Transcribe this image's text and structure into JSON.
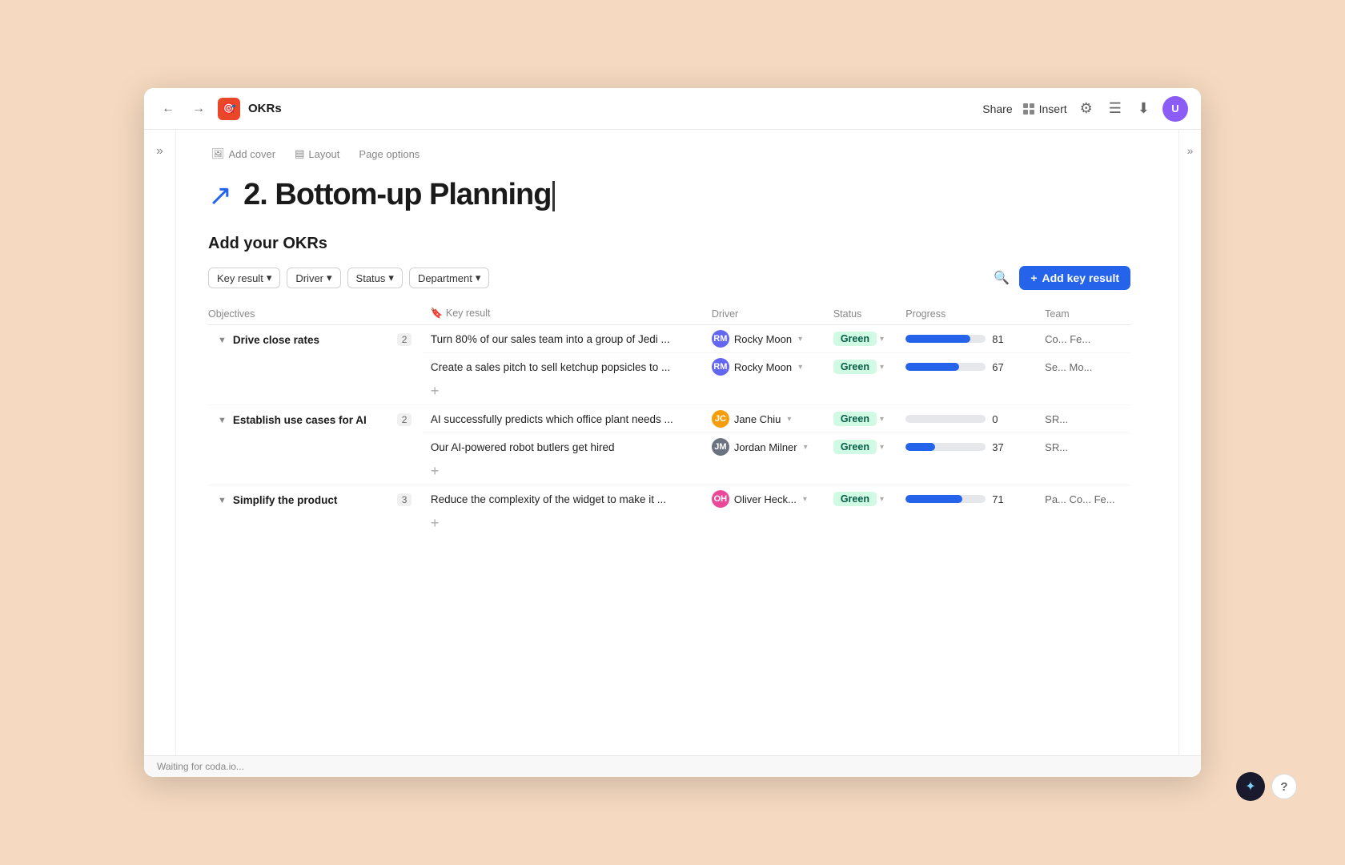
{
  "window": {
    "title": "OKRs"
  },
  "topbar": {
    "back_label": "←",
    "forward_label": "→",
    "doc_icon": "🎯",
    "doc_title": "OKRs",
    "share_label": "Share",
    "insert_label": "Insert",
    "collapse_label": "»"
  },
  "page_toolbar": {
    "add_cover_label": "Add cover",
    "layout_label": "Layout",
    "page_options_label": "Page options"
  },
  "page": {
    "icon": "↗",
    "title": "2. Bottom-up Planning"
  },
  "section": {
    "title": "Add your OKRs"
  },
  "filters": {
    "items": [
      {
        "id": "key-result",
        "label": "Key result"
      },
      {
        "id": "driver",
        "label": "Driver"
      },
      {
        "id": "status",
        "label": "Status"
      },
      {
        "id": "department",
        "label": "Department"
      }
    ],
    "add_key_result_label": "+ Add key result"
  },
  "table": {
    "headers": [
      "Objectives",
      "Key result",
      "Driver",
      "Status",
      "Progress",
      "Team"
    ],
    "objectives": [
      {
        "id": "drive-close-rates",
        "name": "Drive close rates",
        "count": 2,
        "key_results": [
          {
            "id": "kr1",
            "text": "Turn 80% of our sales team into a group of Jedi ...",
            "driver_name": "Rocky Moon",
            "driver_color": "#6366f1",
            "driver_initials": "RM",
            "status": "Green",
            "progress": 81,
            "team": "Co... Fe..."
          },
          {
            "id": "kr2",
            "text": "Create a sales pitch to sell ketchup popsicles to ...",
            "driver_name": "Rocky Moon",
            "driver_color": "#6366f1",
            "driver_initials": "RM",
            "status": "Green",
            "progress": 67,
            "team": "Se... Mo..."
          }
        ]
      },
      {
        "id": "establish-ai",
        "name": "Establish use cases for AI",
        "count": 2,
        "key_results": [
          {
            "id": "kr3",
            "text": "AI successfully predicts which office plant needs ...",
            "driver_name": "Jane Chiu",
            "driver_color": "#f59e0b",
            "driver_initials": "JC",
            "status": "Green",
            "progress": 0,
            "team": "SR..."
          },
          {
            "id": "kr4",
            "text": "Our AI-powered robot butlers get hired",
            "driver_name": "Jordan Milner",
            "driver_color": "#6b7280",
            "driver_initials": "JM",
            "status": "Green",
            "progress": 37,
            "team": "SR..."
          }
        ]
      },
      {
        "id": "simplify-product",
        "name": "Simplify the product",
        "count": 3,
        "key_results": [
          {
            "id": "kr5",
            "text": "Reduce the complexity of the widget to make it ...",
            "driver_name": "Oliver Heck...",
            "driver_color": "#ec4899",
            "driver_initials": "OH",
            "status": "Green",
            "progress": 71,
            "team": "Pa... Co... Fe..."
          }
        ]
      }
    ]
  },
  "bottom_bar": {
    "status": "Waiting for coda.io..."
  },
  "fab": {
    "sparkle": "✦",
    "help": "?"
  }
}
